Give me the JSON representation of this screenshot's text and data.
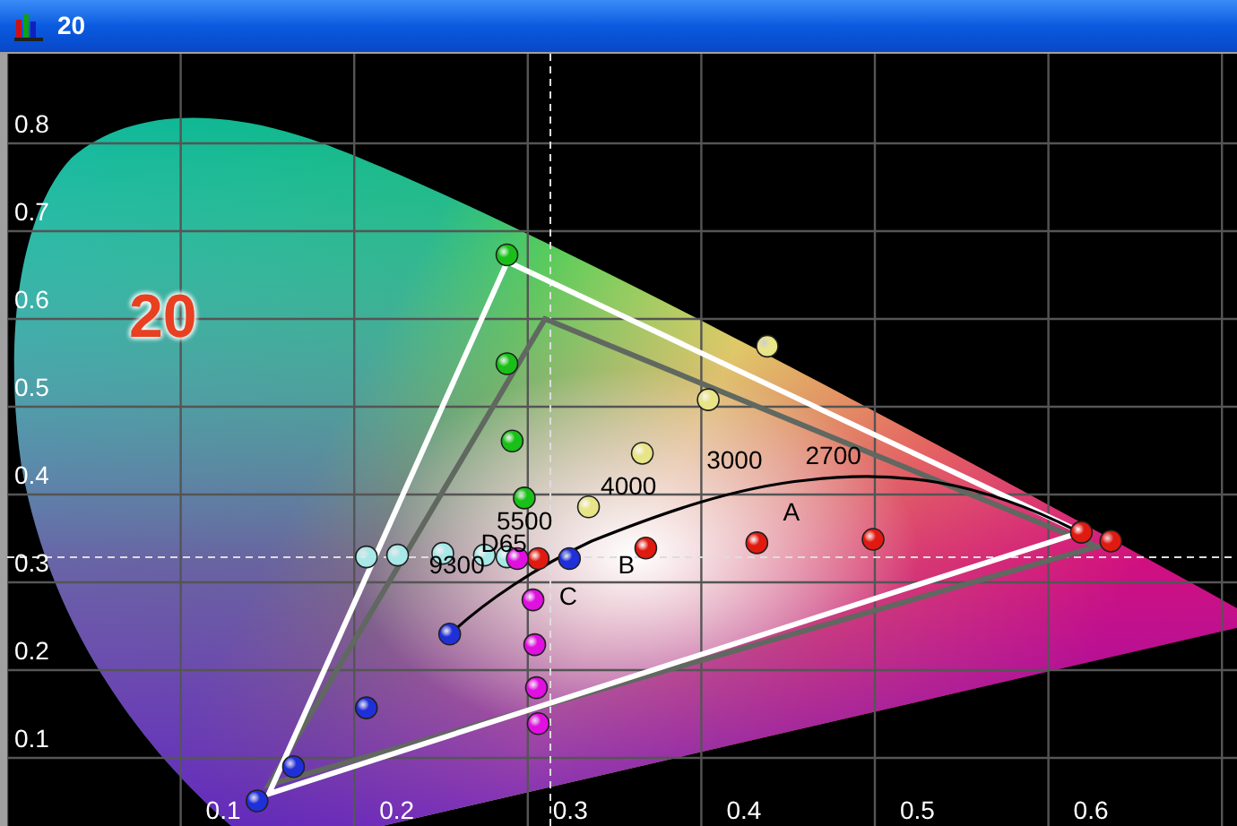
{
  "window": {
    "title": "20"
  },
  "overlay_label": "20",
  "diagram": {
    "x_ticks": [
      "0.1",
      "0.2",
      "0.3",
      "0.4",
      "0.5",
      "0.6"
    ],
    "y_ticks": [
      "0.8",
      "0.7",
      "0.6",
      "0.5",
      "0.4",
      "0.3",
      "0.2",
      "0.1"
    ],
    "point_groups": [
      {
        "color": "#18c018"
      },
      {
        "color": "#e8e488"
      },
      {
        "color": "#e01a10"
      },
      {
        "color": "#a8e8e8"
      },
      {
        "color": "#e010e0"
      },
      {
        "color": "#2030d8"
      }
    ],
    "labels": [
      "9300",
      "D65",
      "5500",
      "4000",
      "3000",
      "2700",
      "A",
      "B",
      "C"
    ]
  }
}
